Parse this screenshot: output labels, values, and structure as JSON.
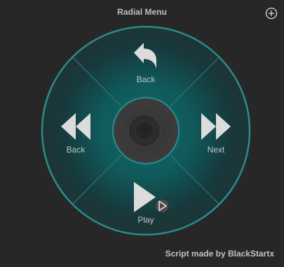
{
  "window": {
    "title": "Radial Menu",
    "add_icon": "plus-circle-icon"
  },
  "radial_menu": {
    "items": [
      {
        "id": "top",
        "label": "Back",
        "icon": "undo-arrow-icon"
      },
      {
        "id": "left",
        "label": "Back",
        "icon": "rewind-icon"
      },
      {
        "id": "right",
        "label": "Next",
        "icon": "fast-forward-icon"
      },
      {
        "id": "bottom",
        "label": "Play",
        "icon": "play-icon"
      }
    ],
    "center_icon": "center-knob-icon"
  },
  "footer": {
    "credit": "Script made by BlackStartx"
  },
  "colors": {
    "background": "#272727",
    "ring_edge": "#2e8a8a",
    "ring_fill": "#1a3c3d",
    "icon_fill": "#dcdcdc"
  }
}
